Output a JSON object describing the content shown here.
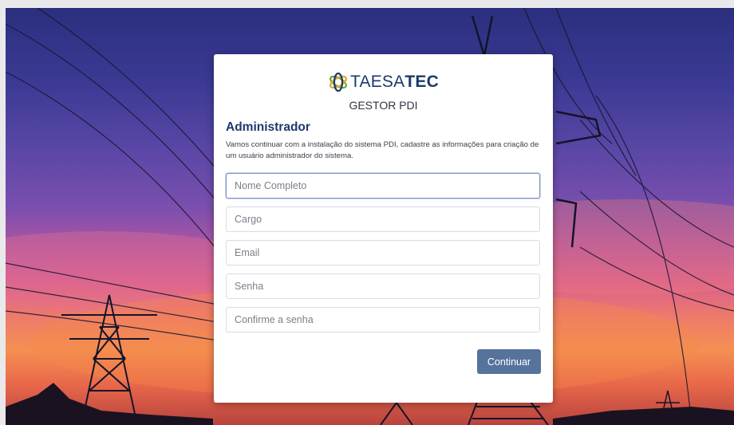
{
  "brand": {
    "logo_icon": "taesatec-knot-icon",
    "name_light": "TAESA",
    "name_bold": "TEC",
    "subtitle": "GESTOR PDI"
  },
  "form": {
    "heading": "Administrador",
    "description": "Vamos continuar com a instalação do sistema PDI, cadastre as informações para criação de um usuário administrador do sistema.",
    "fields": [
      {
        "placeholder": "Nome Completo",
        "value": ""
      },
      {
        "placeholder": "Cargo",
        "value": ""
      },
      {
        "placeholder": "Email",
        "value": ""
      },
      {
        "placeholder": "Senha",
        "value": ""
      },
      {
        "placeholder": "Confirme a senha",
        "value": ""
      }
    ],
    "submit_label": "Continuar"
  },
  "colors": {
    "brand_blue": "#1c3a6b",
    "button": "#56739c",
    "logo_green": "#6ea33a",
    "logo_gold": "#e0a72a"
  }
}
